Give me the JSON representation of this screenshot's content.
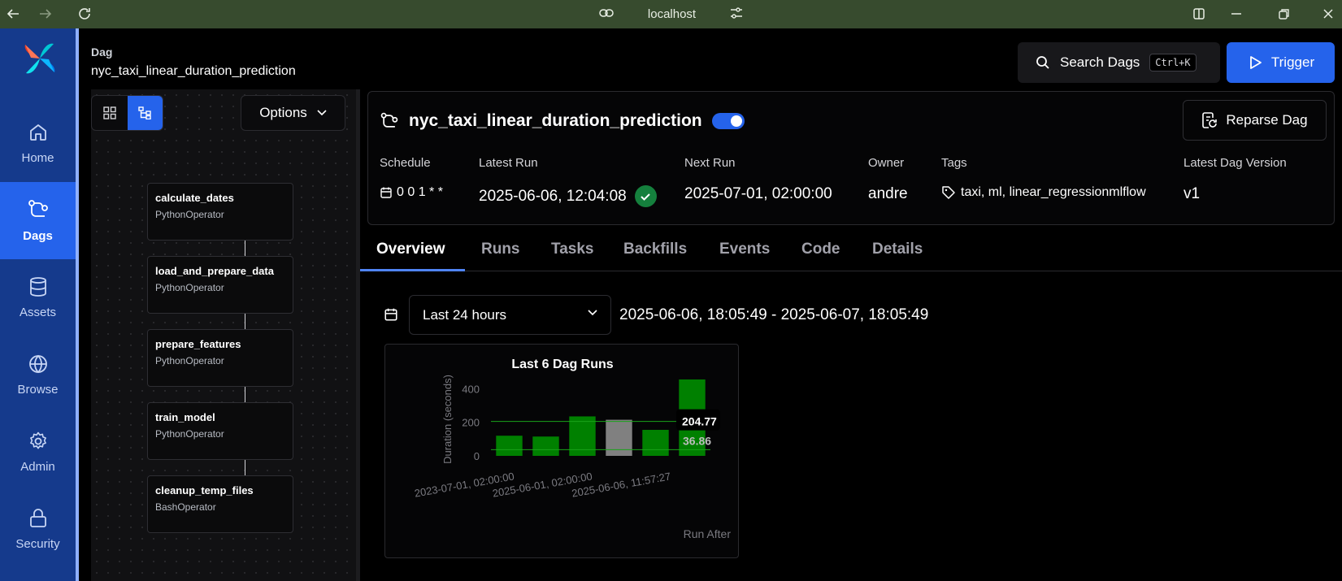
{
  "browser": {
    "url": "localhost",
    "icons": [
      "back-icon",
      "forward-icon",
      "reload-icon",
      "link-icon",
      "tune-icon",
      "split-view-icon",
      "minimize-icon",
      "restore-icon",
      "close-icon"
    ]
  },
  "sidebar": {
    "items": [
      {
        "label": "Home",
        "icon": "home-icon"
      },
      {
        "label": "Dags",
        "icon": "dags-icon",
        "active": true
      },
      {
        "label": "Assets",
        "icon": "database-icon"
      },
      {
        "label": "Browse",
        "icon": "globe-icon"
      },
      {
        "label": "Admin",
        "icon": "gear-icon"
      },
      {
        "label": "Security",
        "icon": "lock-icon"
      }
    ]
  },
  "header": {
    "section_label": "Dag",
    "dag_name": "nyc_taxi_linear_duration_prediction",
    "search_label": "Search Dags",
    "search_shortcut": "Ctrl+K",
    "trigger_label": "Trigger"
  },
  "graph": {
    "options_label": "Options",
    "tasks": [
      {
        "name": "calculate_dates",
        "operator": "PythonOperator"
      },
      {
        "name": "load_and_prepare_data",
        "operator": "PythonOperator"
      },
      {
        "name": "prepare_features",
        "operator": "PythonOperator"
      },
      {
        "name": "train_model",
        "operator": "PythonOperator"
      },
      {
        "name": "cleanup_temp_files",
        "operator": "BashOperator"
      }
    ]
  },
  "details": {
    "title": "nyc_taxi_linear_duration_prediction",
    "paused": false,
    "reparse_label": "Reparse Dag",
    "headers": {
      "schedule": "Schedule",
      "latest_run": "Latest Run",
      "next_run": "Next Run",
      "owner": "Owner",
      "tags": "Tags",
      "latest_version": "Latest Dag Version"
    },
    "values": {
      "schedule": "0 0 1 * *",
      "latest_run": "2025-06-06, 12:04:08",
      "latest_run_status": "success",
      "next_run": "2025-07-01, 02:00:00",
      "owner": "andre",
      "tags": "taxi, ml, linear_regressionmlflow",
      "latest_version": "v1"
    }
  },
  "tabs": [
    "Overview",
    "Runs",
    "Tasks",
    "Backfills",
    "Events",
    "Code",
    "Details"
  ],
  "active_tab": "Overview",
  "range": {
    "selected": "Last 24 hours",
    "text": "2025-06-06, 18:05:49 - 2025-06-07, 18:05:49"
  },
  "colors": {
    "accent": "#2563eb",
    "sidebar_bg": "#153a8c",
    "success": "#008000",
    "running": "#808080"
  },
  "chart_data": {
    "type": "bar",
    "title": "Last 6 Dag Runs",
    "ylabel": "Duration (seconds)",
    "xlabel": "Run After",
    "ylim": [
      0,
      450
    ],
    "yticks": [
      0,
      200,
      400
    ],
    "xtick_labels": [
      "2023-07-01, 02:00:00",
      "2025-06-01, 02:00:00",
      "2025-06-06, 11:57:27"
    ],
    "values": [
      120,
      115,
      235,
      215,
      155,
      455
    ],
    "bar_colors": [
      "#008000",
      "#008000",
      "#008000",
      "#808080",
      "#008000",
      "#008000"
    ],
    "reference_lines": [
      {
        "value": 204.77,
        "label": "204.77"
      },
      {
        "value": 36.86,
        "label": "36.86"
      }
    ]
  }
}
